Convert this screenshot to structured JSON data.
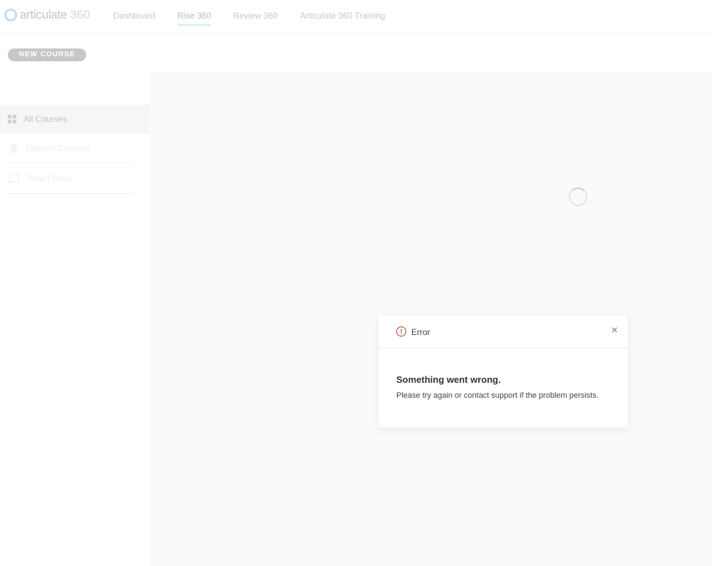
{
  "header": {
    "logo_text": "articulate",
    "logo_number": "360",
    "nav": [
      {
        "label": "Dashboard",
        "active": false
      },
      {
        "label": "Rise 360",
        "active": true
      },
      {
        "label": "Review 360",
        "active": false
      },
      {
        "label": "Articulate 360 Training",
        "active": false
      }
    ]
  },
  "toolbar": {
    "new_course_label": "NEW COURSE"
  },
  "sidebar": {
    "items": [
      {
        "label": "All Courses",
        "icon": "grid-icon"
      },
      {
        "label": "Deleted Courses",
        "icon": "trash-icon"
      },
      {
        "label": "New Folder",
        "icon": "folder-plus-icon"
      }
    ]
  },
  "dialog": {
    "title": "Error",
    "heading": "Something went wrong.",
    "message": "Please try again or contact support if the problem persists.",
    "close_symbol": "×",
    "error_symbol": "!",
    "accent": "#b23a3a"
  }
}
